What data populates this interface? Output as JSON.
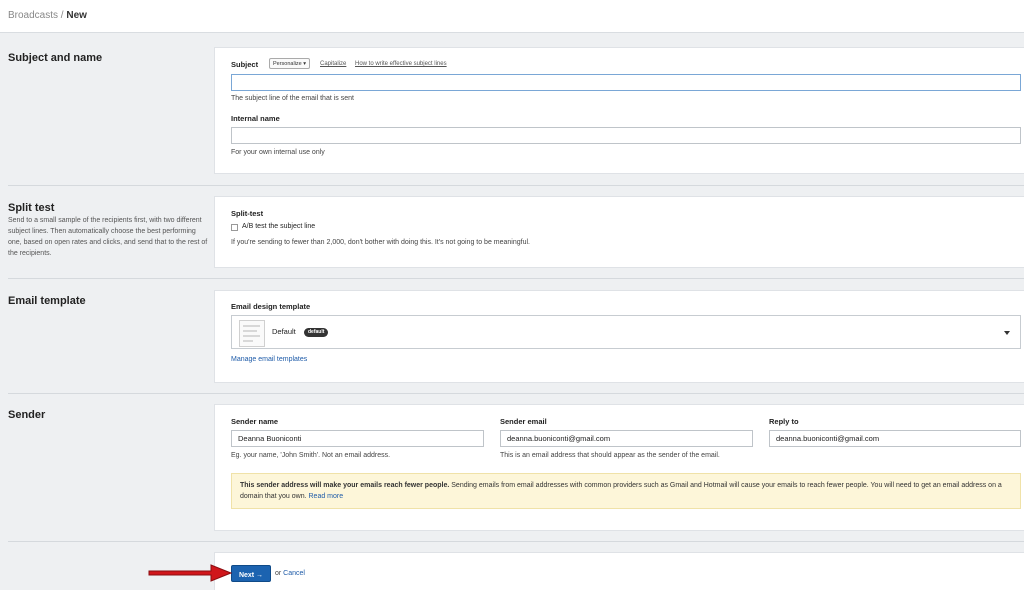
{
  "breadcrumb": {
    "parent": "Broadcasts",
    "separator": " / ",
    "current": "New"
  },
  "sections": {
    "subject": {
      "title": "Subject and name",
      "subject_label": "Subject",
      "personalize": "Personalize ▾",
      "capitalize": "Capitalize",
      "howto": "How to write effective subject lines",
      "subject_value": "",
      "subject_help": "The subject line of the email that is sent",
      "internal_label": "Internal name",
      "internal_value": "",
      "internal_help": "For your own internal use only"
    },
    "split": {
      "title": "Split test",
      "description": "Send to a small sample of the recipients first, with two different subject lines. Then automatically choose the best performing one, based on open rates and clicks, and send that to the rest of the recipients.",
      "label": "Split-test",
      "checkbox_label": "A/B test the subject line",
      "checked": false,
      "help": "If you're sending to fewer than 2,000, don't bother with doing this. It's not going to be meaningful."
    },
    "template": {
      "title": "Email template",
      "label": "Email design template",
      "selected": "Default",
      "badge": "default",
      "manage_link": "Manage email templates"
    },
    "sender": {
      "title": "Sender",
      "name_label": "Sender name",
      "name_value": "Deanna Buoniconti",
      "name_help": "Eg. your name, 'John Smith'. Not an email address.",
      "email_label": "Sender email",
      "email_value": "deanna.buoniconti@gmail.com",
      "email_help": "This is an email address that should appear as the sender of the email.",
      "reply_label": "Reply to",
      "reply_value": "deanna.buoniconti@gmail.com",
      "warning_bold": "This sender address will make your emails reach fewer people.",
      "warning_text": " Sending emails from email addresses with common providers such as Gmail and Hotmail will cause your emails to reach fewer people. You will need to get an email address on a domain that you own. ",
      "warning_link": "Read more"
    }
  },
  "footer": {
    "next_label": "Next →",
    "or_text": "or ",
    "cancel_label": "Cancel"
  },
  "colors": {
    "primary": "#1c63b0",
    "warning_bg": "#fdf6d9",
    "arrow": "#d0161b",
    "page_bg": "#eef0f2"
  }
}
